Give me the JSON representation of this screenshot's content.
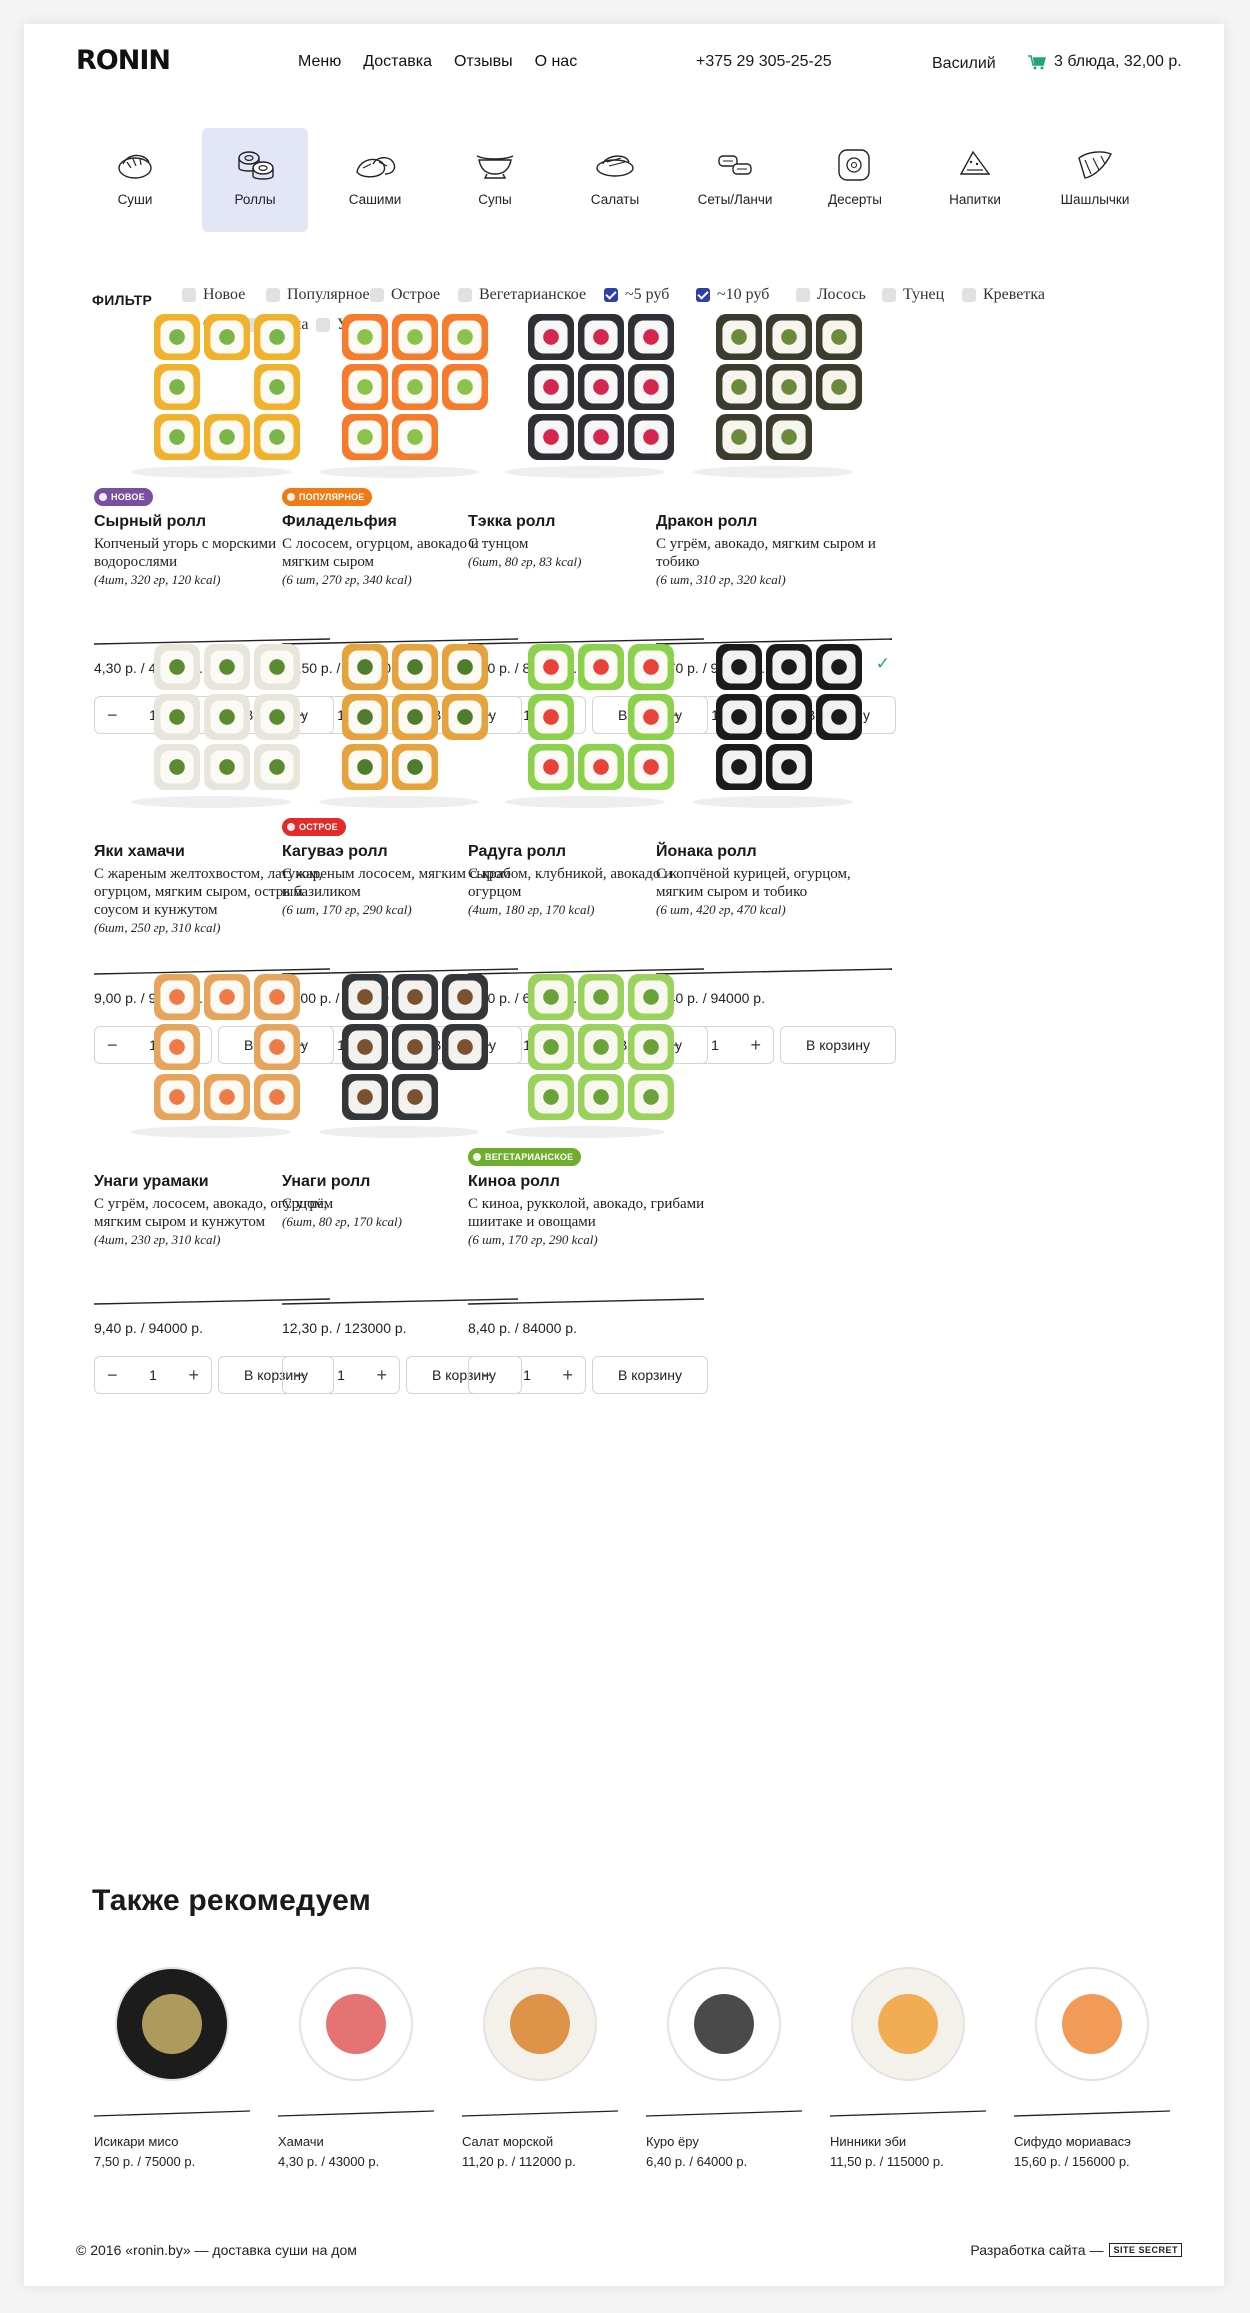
{
  "header": {
    "logo_text": "RONIN",
    "nav": [
      "Меню",
      "Доставка",
      "Отзывы",
      "О нас"
    ],
    "phone": "+375 29 305-25-25",
    "user": "Василий",
    "cart": "3 блюда, 32,00 р."
  },
  "categories": [
    {
      "label": "Суши",
      "icon": "sushi-icon"
    },
    {
      "label": "Роллы",
      "icon": "rolls-icon",
      "active": true
    },
    {
      "label": "Сашими",
      "icon": "sashimi-icon"
    },
    {
      "label": "Супы",
      "icon": "soup-icon"
    },
    {
      "label": "Салаты",
      "icon": "salad-icon"
    },
    {
      "label": "Сеты/Ланчи",
      "icon": "sets-icon"
    },
    {
      "label": "Десерты",
      "icon": "dessert-icon"
    },
    {
      "label": "Напитки",
      "icon": "drinks-icon"
    },
    {
      "label": "Шашлычки",
      "icon": "skewers-icon"
    }
  ],
  "filter": {
    "label": "ФИЛЬТР",
    "options": [
      {
        "label": "Новое",
        "checked": false
      },
      {
        "label": "Популярное",
        "checked": false
      },
      {
        "label": "Острое",
        "checked": false
      },
      {
        "label": "Вегетарианское",
        "checked": false
      },
      {
        "label": "~5 руб",
        "checked": true
      },
      {
        "label": "~10 руб",
        "checked": true
      },
      {
        "label": "Лосось",
        "checked": false
      },
      {
        "label": "Тунец",
        "checked": false
      },
      {
        "label": "Креветка",
        "checked": false
      },
      {
        "label": "Окунь",
        "checked": false
      },
      {
        "label": "Акула",
        "checked": false
      },
      {
        "label": "Угорь",
        "checked": false
      }
    ]
  },
  "products": [
    {
      "name": "Сырный ролл",
      "desc": "Копченый угорь с морскими водорослями",
      "info": "(4шт, 320 гр, 120 kcal)",
      "price": "4,30 р. / 43000 р.",
      "badge": "НОВОЕ",
      "badge_color": "#7a4ea0",
      "qty": "1"
    },
    {
      "name": "Филадельфия",
      "desc": "С лососем, огурцом, авокадо и мягким сыром",
      "info": "(6 шт, 270 гр, 340 kcal)",
      "price": "12,50 р. / 125000 р.",
      "badge": "ПОПУЛЯРНОЕ",
      "badge_color": "#f07b14",
      "qty": "1"
    },
    {
      "name": "Тэкка ролл",
      "desc": "С тунцом",
      "info": "(6шт, 80 гр, 83 kcal)",
      "price": "8,70 р. / 87000 р.",
      "qty": "1"
    },
    {
      "name": "Дракон ролл",
      "desc": "С угрём, авокадо, мягким сыром и тобико",
      "info": "(6 шт, 310 гр, 320 kcal)",
      "price": "9,70 р. / 97000 р.",
      "check": "✓",
      "qty": "1"
    },
    {
      "name": "Яки хамачи",
      "desc": "С жареным желтохвостом, латуком, огурцом, мягким сыром, острым соусом и кунжутом",
      "info": "(6шт, 250 гр, 310 kcal)",
      "price": "9,00 р. / 90000 р.",
      "qty": "1"
    },
    {
      "name": "Кагуваэ ролл",
      "desc": "С жареным лососем, мягким сыром и базиликом",
      "info": "(6 шт, 170 гр, 290 kcal)",
      "price": "11,00 р. / 110000 р.",
      "badge": "ОСТРОЕ",
      "badge_color": "#e32b2b",
      "qty": "1"
    },
    {
      "name": "Радуга ролл",
      "desc": "С крабом, клубникой, авокадо и огурцом",
      "info": "(4шт, 180 гр, 170 kcal)",
      "price": "6,50 р. / 65000 р.",
      "qty": "1"
    },
    {
      "name": "Йонака ролл",
      "desc": "С копчёной курицей, огурцом, мягким сыром и тобико",
      "info": "(6 шт, 420 гр, 470 kcal)",
      "price": "9,40 р. / 94000 р.",
      "qty": "1"
    },
    {
      "name": "Унаги урамаки",
      "desc": "С угрём, лососем, авокадо, огурцом, мягким сыром и кунжутом",
      "info": "(4шт, 230 гр, 310 kcal)",
      "price": "9,40 р. / 94000 р.",
      "qty": "1"
    },
    {
      "name": "Унаги ролл",
      "desc": "С угрём",
      "info": "(6шт, 80 гр, 170 kcal)",
      "price": "12,30 р. / 123000 р.",
      "qty": "1"
    },
    {
      "name": "Киноа ролл",
      "desc": "С киноа, рукколой, авокадо, грибами шиитаке и овощами",
      "info": "(6 шт, 170 гр, 290 kcal)",
      "price": "8,40 р. / 84000 р.",
      "badge": "ВЕГЕТАРИАНСКОЕ",
      "badge_color": "#6fae2c",
      "qty": "1"
    }
  ],
  "to_cart_label": "В корзину",
  "also": {
    "title": "Также рекомедуем",
    "items": [
      {
        "name": "Исикари мисо",
        "price": "7,50 р. / 75000 р."
      },
      {
        "name": "Хамачи",
        "price": "4,30 р. / 43000 р."
      },
      {
        "name": "Салат морской",
        "price": "11,20 р. / 112000 р."
      },
      {
        "name": "Куро ёру",
        "price": "6,40 р. / 64000 р."
      },
      {
        "name": "Нинники эби",
        "price": "11,50 р. / 115000 р."
      },
      {
        "name": "Сифудо мориавасэ",
        "price": "15,60 р. / 156000 р."
      }
    ]
  },
  "footer": {
    "copyright": "© 2016 «ronin.by» — доставка суши на дом",
    "dev_label": "Разработка сайта —",
    "dev_logo": "SITE SECRET"
  }
}
